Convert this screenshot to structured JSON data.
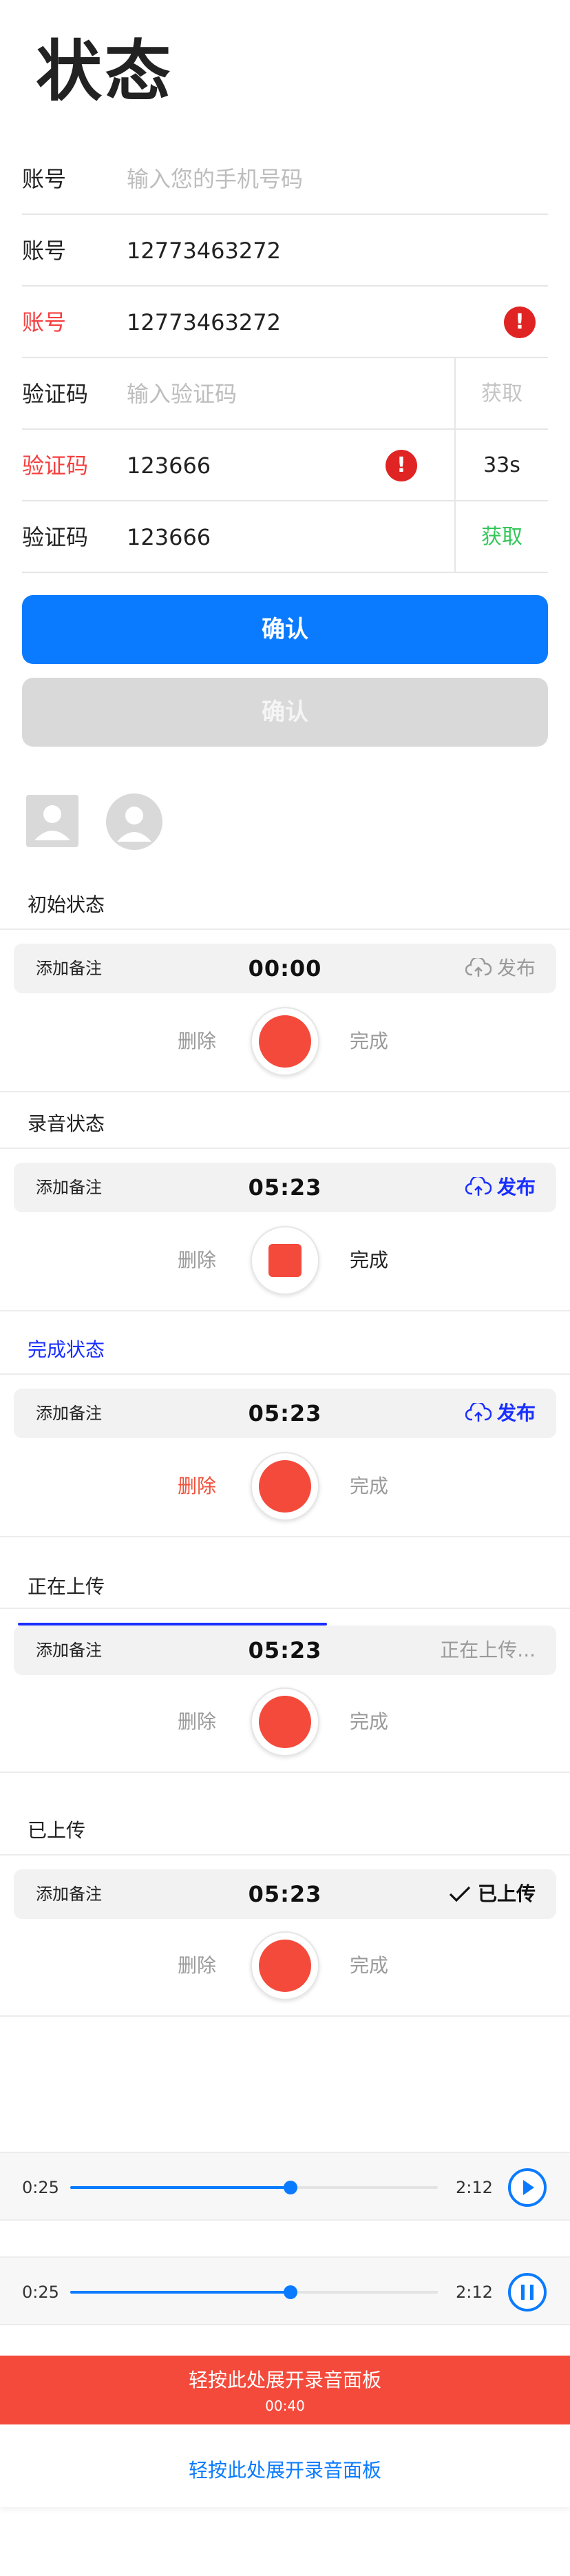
{
  "page": {
    "title": "状态"
  },
  "form": {
    "rows": [
      {
        "label": "账号",
        "value": "输入您的手机号码"
      },
      {
        "label": "账号",
        "value": "12773463272"
      },
      {
        "label": "账号",
        "value": "12773463272",
        "error_icon": "!"
      },
      {
        "label": "验证码",
        "value": "输入验证码",
        "side": "获取"
      },
      {
        "label": "验证码",
        "value": "123666",
        "error_icon": "!",
        "side": "33s"
      },
      {
        "label": "验证码",
        "value": "123666",
        "side": "获取"
      }
    ],
    "confirm_label": "确认",
    "confirm_disabled_label": "确认"
  },
  "icons": {
    "avatar_square": "person-square-icon",
    "avatar_circle": "person-circle-icon",
    "upload": "cloud-upload-icon",
    "check": "check-icon",
    "play": "play-icon",
    "pause": "pause-icon",
    "error": "exclamation-circle-icon"
  },
  "recorder": {
    "sections": [
      {
        "title": "初始状态",
        "note": "添加备注",
        "time": "00:00",
        "action": "发布",
        "delete": "删除",
        "done": "完成"
      },
      {
        "title": "录音状态",
        "note": "添加备注",
        "time": "05:23",
        "action": "发布",
        "delete": "删除",
        "done": "完成"
      },
      {
        "title": "完成状态",
        "note": "添加备注",
        "time": "05:23",
        "action": "发布",
        "delete": "删除",
        "done": "完成"
      },
      {
        "title": "正在上传",
        "note": "添加备注",
        "time": "05:23",
        "action": "正在上传...",
        "delete": "删除",
        "done": "完成",
        "upload_progress": 0.57
      },
      {
        "title": "已上传",
        "note": "添加备注",
        "time": "05:23",
        "action": "已上传",
        "delete": "删除",
        "done": "完成"
      }
    ]
  },
  "players": [
    {
      "current": "0:25",
      "total": "2:12",
      "progress": 0.6,
      "state": "paused"
    },
    {
      "current": "0:25",
      "total": "2:12",
      "progress": 0.6,
      "state": "playing"
    }
  ],
  "panel": {
    "expand_label": "轻按此处展开录音面板",
    "expand_time": "00:40",
    "expand_label_plain": "轻按此处展开录音面板"
  },
  "colors": {
    "primary": "#0a7bff",
    "error": "#f53f3f",
    "record": "#f44a3b",
    "link_blue": "#1a2fff",
    "success": "#34c759"
  }
}
